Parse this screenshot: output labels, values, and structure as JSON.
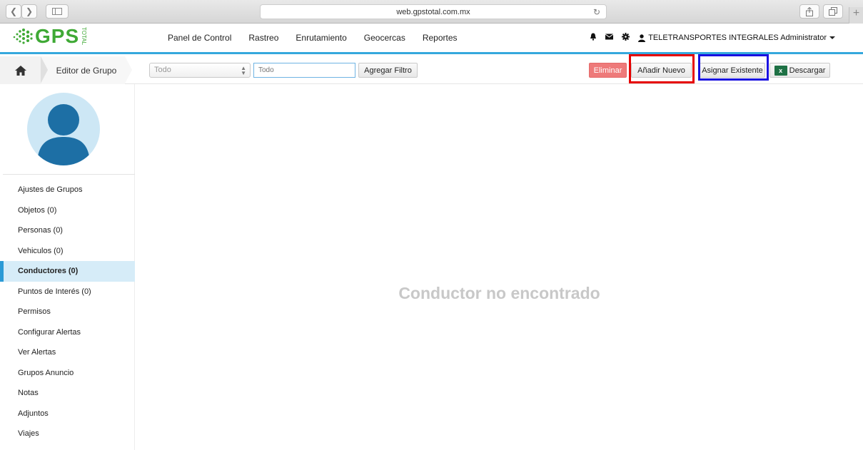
{
  "browser": {
    "url": "web.gpstotal.com.mx",
    "back_icon": "chevron-left",
    "forward_icon": "chevron-right",
    "sidebar_icon": "sidebar",
    "reload_icon": "reload",
    "share_icon": "share",
    "tabs_icon": "tabs",
    "newtab_icon": "plus"
  },
  "app": {
    "logo_text": "GPS",
    "logo_sub": "TOTAL",
    "nav": [
      "Panel de Control",
      "Rastreo",
      "Enrutamiento",
      "Geocercas",
      "Reportes"
    ],
    "user": "TELETRANSPORTES INTEGRALES Administrator",
    "accent_color": "#35a8dd"
  },
  "toolbar": {
    "breadcrumb_title": "Editor de Grupo",
    "filter_select": "Todo",
    "filter_placeholder": "Todo",
    "add_filter": "Agregar Filtro",
    "delete": "Eliminar",
    "add_new": "Añadir Nuevo",
    "assign_existing": "Asignar Existente",
    "download": "Descargar"
  },
  "sidebar": {
    "items": [
      {
        "label": "Ajustes de Grupos"
      },
      {
        "label": "Objetos (0)"
      },
      {
        "label": "Personas (0)"
      },
      {
        "label": "Vehiculos (0)"
      },
      {
        "label": "Conductores (0)",
        "active": true
      },
      {
        "label": "Puntos de Interés (0)"
      },
      {
        "label": "Permisos"
      },
      {
        "label": "Configurar Alertas"
      },
      {
        "label": "Ver Alertas"
      },
      {
        "label": "Grupos Anuncio"
      },
      {
        "label": "Notas"
      },
      {
        "label": "Adjuntos"
      },
      {
        "label": "Viajes"
      }
    ]
  },
  "main": {
    "empty_message": "Conductor no encontrado"
  }
}
